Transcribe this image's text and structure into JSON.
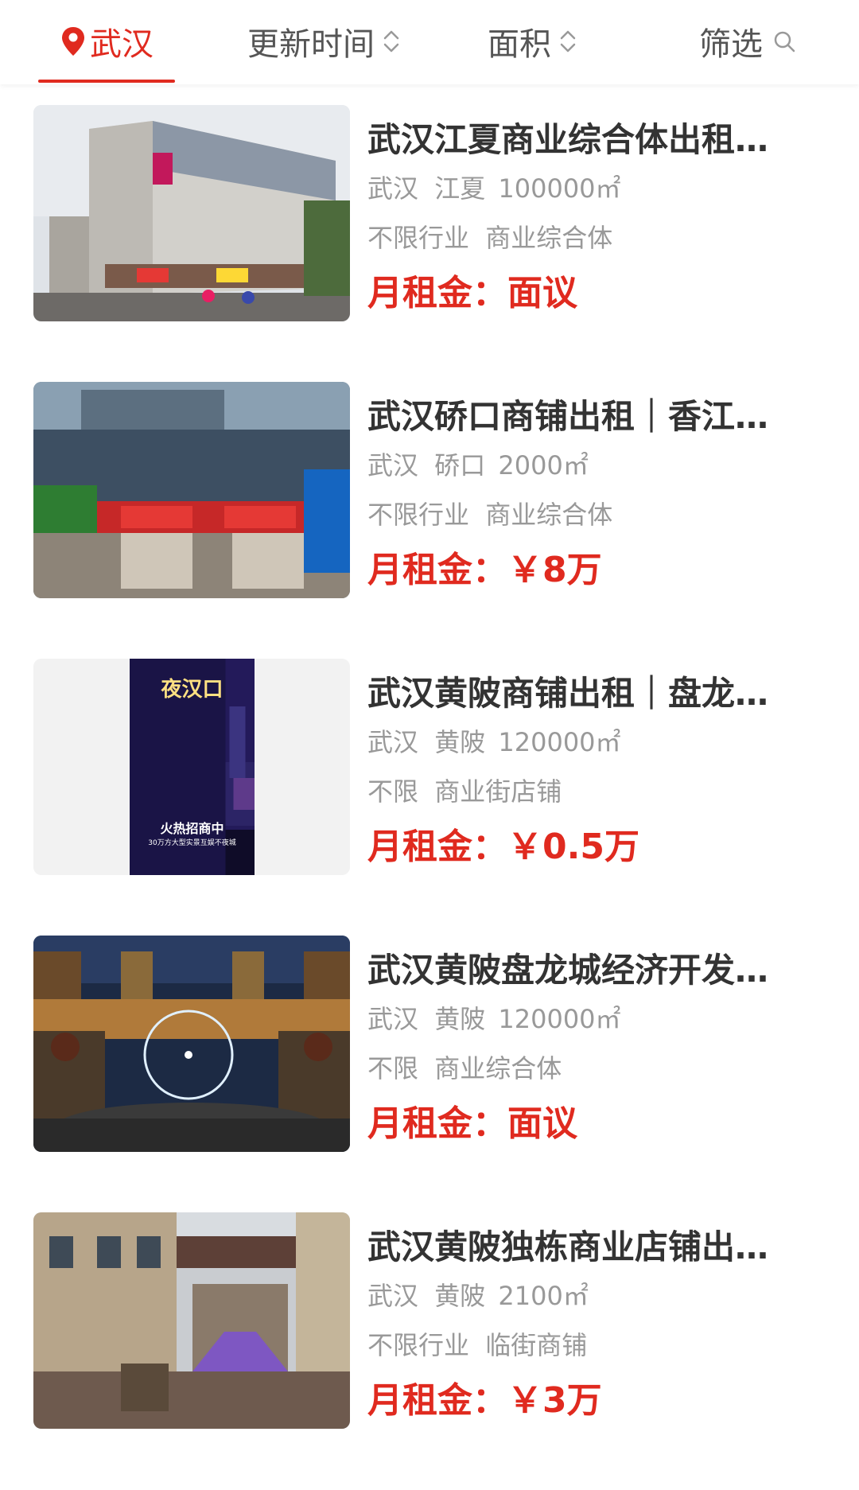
{
  "filter_bar": {
    "city": "武汉",
    "update_time": "更新时间",
    "area": "面积",
    "screen": "筛选"
  },
  "colors": {
    "accent": "#e02a1f",
    "title": "#333333",
    "meta": "#999999"
  },
  "listings": [
    {
      "title": "武汉江夏商业综合体出租…",
      "city": "武汉",
      "district": "江夏",
      "area": "100000㎡",
      "industry": "不限行业",
      "type": "商业综合体",
      "price": "月租金：面议"
    },
    {
      "title": "武汉硚口商铺出租｜香江…",
      "city": "武汉",
      "district": "硚口",
      "area": "2000㎡",
      "industry": "不限行业",
      "type": "商业综合体",
      "price": "月租金：￥8万"
    },
    {
      "title": "武汉黄陂商铺出租｜盘龙…",
      "city": "武汉",
      "district": "黄陂",
      "area": "120000㎡",
      "industry": "不限",
      "type": "商业街店铺",
      "price": "月租金：￥0.5万",
      "poster_title": "夜汉口",
      "poster_slogan": "火热招商中",
      "poster_sub": "30万方大型实景互娱不夜城"
    },
    {
      "title": "武汉黄陂盘龙城经济开发…",
      "city": "武汉",
      "district": "黄陂",
      "area": "120000㎡",
      "industry": "不限",
      "type": "商业综合体",
      "price": "月租金：面议"
    },
    {
      "title": "武汉黄陂独栋商业店铺出…",
      "city": "武汉",
      "district": "黄陂",
      "area": "2100㎡",
      "industry": "不限行业",
      "type": "临街商铺",
      "price": "月租金：￥3万"
    }
  ]
}
